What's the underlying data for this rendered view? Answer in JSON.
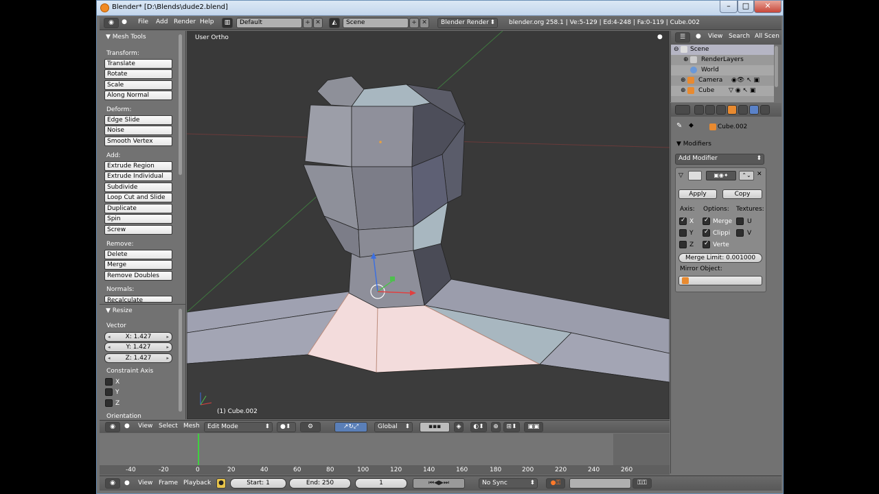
{
  "window": {
    "title": "Blender* [D:\\Blends\\dude2.blend]"
  },
  "topbar": {
    "menus": [
      "File",
      "Add",
      "Render",
      "Help"
    ],
    "layout": "Default",
    "scene": "Scene",
    "engine": "Blender Render",
    "stats": "blender.org 258.1 | Ve:5-129 | Ed:4-248 | Fa:0-119 | Cube.002"
  },
  "toolshelf": {
    "title": "Mesh Tools",
    "sections": [
      {
        "label": "Transform:",
        "items": [
          "Translate",
          "Rotate",
          "Scale",
          "Along Normal"
        ]
      },
      {
        "label": "Deform:",
        "items": [
          "Edge Slide",
          "Noise",
          "Smooth Vertex"
        ]
      },
      {
        "label": "Add:",
        "items": [
          "Extrude Region",
          "Extrude Individual",
          "Subdivide",
          "Loop Cut and Slide",
          "Duplicate",
          "Spin",
          "Screw"
        ]
      },
      {
        "label": "Remove:",
        "items": [
          "Delete",
          "Merge",
          "Remove Doubles"
        ]
      },
      {
        "label": "Normals:",
        "items": [
          "Recalculate"
        ]
      }
    ],
    "resize": {
      "title": "Resize",
      "vector_label": "Vector",
      "x": "X: 1.427",
      "y": "Y: 1.427",
      "z": "Z: 1.427",
      "constraint_label": "Constraint Axis",
      "axes": [
        "X",
        "Y",
        "Z"
      ],
      "orientation_label": "Orientation"
    }
  },
  "viewport": {
    "view_name": "User Ortho",
    "object_label": "(1) Cube.002"
  },
  "viewport_header": {
    "menus": [
      "View",
      "Select",
      "Mesh"
    ],
    "mode": "Edit Mode",
    "orientation": "Global"
  },
  "timeline": {
    "ticks": [
      "-40",
      "-20",
      "0",
      "20",
      "40",
      "60",
      "80",
      "100",
      "120",
      "140",
      "160",
      "180",
      "200",
      "220",
      "240",
      "260"
    ],
    "menus": [
      "View",
      "Frame",
      "Playback"
    ],
    "start": "Start: 1",
    "end": "End: 250",
    "current": "1",
    "sync": "No Sync"
  },
  "outliner": {
    "menus": [
      "View",
      "Search",
      "All Scen"
    ],
    "items": [
      "Scene",
      "RenderLayers",
      "World",
      "Camera",
      "Cube"
    ]
  },
  "properties": {
    "object_name": "Cube.002",
    "modifiers_title": "Modifiers",
    "add_modifier": "Add Modifier",
    "apply": "Apply",
    "copy": "Copy",
    "axis_label": "Axis:",
    "options_label": "Options:",
    "textures_label": "Textures:",
    "axes": [
      "X",
      "Y",
      "Z"
    ],
    "options": [
      "Merge",
      "Clippi",
      "Verte"
    ],
    "textures": [
      "U",
      "V"
    ],
    "merge_limit": "Merge Limit: 0.001000",
    "mirror_object": "Mirror Object:"
  },
  "colors": {
    "selected_face": "#f3dcdc",
    "mesh_face": "#a3a5b4",
    "grid_bg": "#393939",
    "accent": "#f08a24"
  }
}
